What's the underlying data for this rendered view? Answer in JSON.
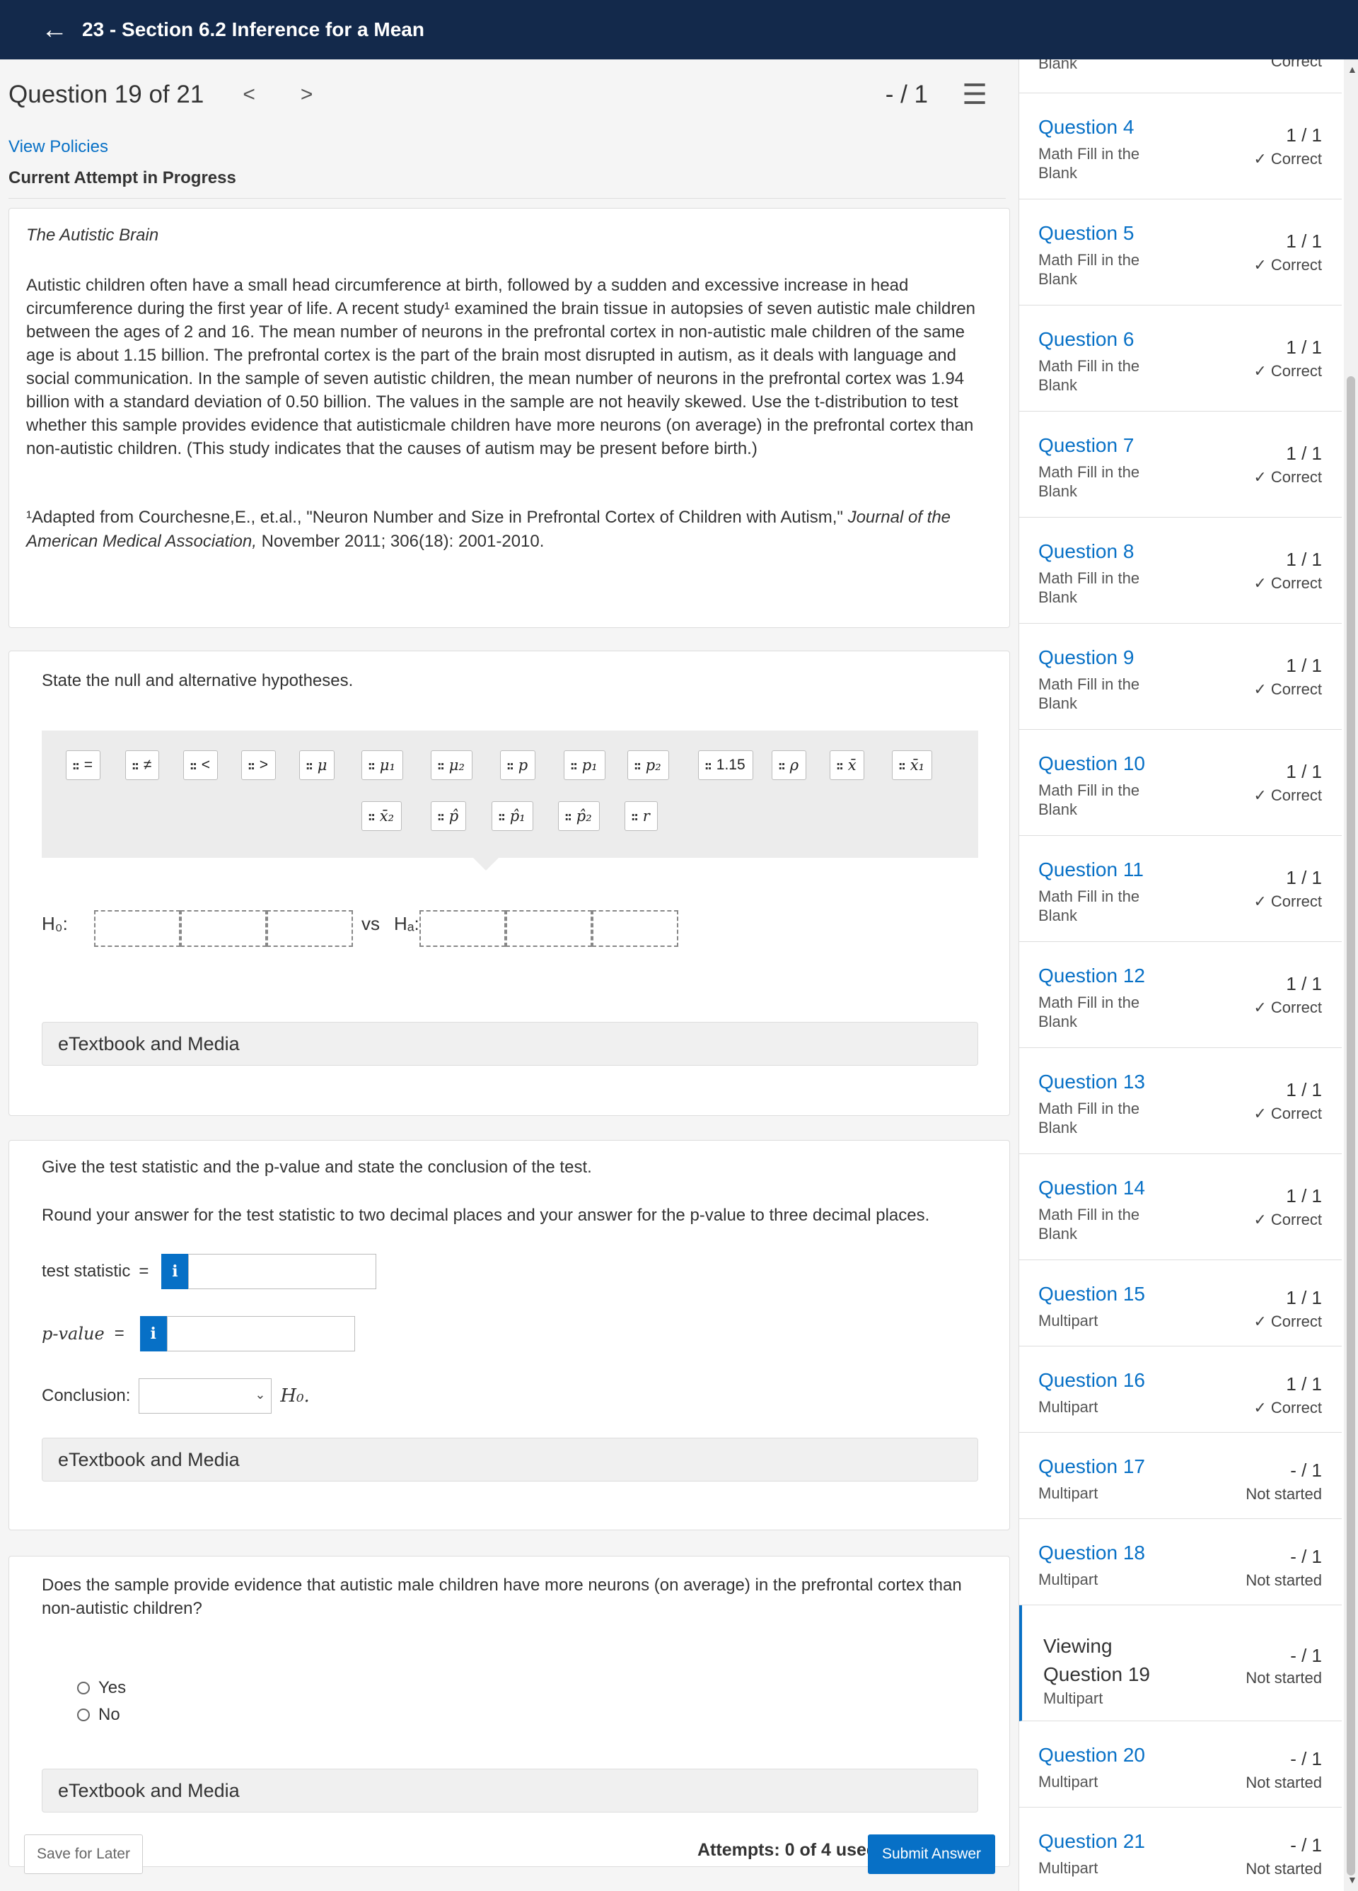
{
  "header": {
    "back_icon": "arrow-left-icon",
    "title": "23 - Section 6.2 Inference for a Mean"
  },
  "question": {
    "number_label": "Question 19 of 21",
    "prev": "<",
    "next": ">",
    "score": "- / 1",
    "list_icon": "numbered-list-icon",
    "view_policies": "View Policies",
    "attempt_status": "Current Attempt in Progress"
  },
  "problem": {
    "title": "The Autistic Brain",
    "text": "Autistic children often have a small head circumference at birth, followed by a sudden and excessive increase in head circumference during the first year of life. A recent study¹ examined the brain tissue in autopsies of seven autistic male children between the ages of 2 and 16. The mean number of neurons in the prefrontal cortex in non-autistic male children of the same age is about 1.15 billion. The prefrontal cortex is the part of the brain most disrupted in autism, as it deals with language and social communication. In the sample of seven autistic children, the mean number of neurons in the prefrontal cortex was 1.94 billion with a standard deviation of 0.50 billion. The values in the sample are not heavily skewed. Use the t-distribution to test whether this sample provides evidence that autisticmale children have more neurons (on average) in the prefrontal cortex than non-autistic children. (This study indicates that the causes of autism may be present before birth.)",
    "footnote_a": "¹Adapted from Courchesne,E., et.al., \"Neuron Number and Size in Prefrontal Cortex of Children with Autism,\"",
    "footnote_journal": "Journal of the American Medical Association,",
    "footnote_b": "November 2011; 306(18): 2001-2010."
  },
  "part1": {
    "prompt": "State the null and alternative hypotheses.",
    "chips_row1": [
      "=",
      "≠",
      "<",
      ">",
      "μ",
      "μ₁",
      "μ₂",
      "p",
      "p₁",
      "p₂",
      "1.15",
      "ρ",
      "x̄",
      "x̄₁"
    ],
    "chips_row2": [
      "x̄₂",
      "p̂",
      "p̂₁",
      "p̂₂",
      "r"
    ],
    "h0_label": "H₀:",
    "vs_label": "vs",
    "ha_label": "Hₐ:",
    "etextbook": "eTextbook and Media"
  },
  "part2": {
    "prompt": "Give the test statistic and the p-value and state the conclusion of the test.",
    "round_note": "Round your answer for the test statistic to two decimal places and your answer for the p-value to three decimal places.",
    "test_stat_label": "test statistic",
    "p_value_label": "p-value",
    "equals": "=",
    "info": "i",
    "conclusion_label": "Conclusion:",
    "conclusion_value": "",
    "h0_suffix": "H₀.",
    "etextbook": "eTextbook and Media"
  },
  "part3": {
    "prompt": "Does the sample provide evidence that autistic male children have more neurons (on average) in the prefrontal cortex than non-autistic children?",
    "options": [
      "Yes",
      "No"
    ],
    "etextbook": "eTextbook and Media"
  },
  "footer": {
    "save_later": "Save for Later",
    "attempts": "Attempts: 0 of 4 used",
    "submit": "Submit Answer"
  },
  "sidebar": {
    "top_partial_type": "Blank",
    "top_partial_status": "Correct",
    "items": [
      {
        "title": "Question 4",
        "type": "Math Fill in the Blank",
        "score": "1 / 1",
        "status": "✓ Correct"
      },
      {
        "title": "Question 5",
        "type": "Math Fill in the Blank",
        "score": "1 / 1",
        "status": "✓ Correct"
      },
      {
        "title": "Question 6",
        "type": "Math Fill in the Blank",
        "score": "1 / 1",
        "status": "✓ Correct"
      },
      {
        "title": "Question 7",
        "type": "Math Fill in the Blank",
        "score": "1 / 1",
        "status": "✓ Correct"
      },
      {
        "title": "Question 8",
        "type": "Math Fill in the Blank",
        "score": "1 / 1",
        "status": "✓ Correct"
      },
      {
        "title": "Question 9",
        "type": "Math Fill in the Blank",
        "score": "1 / 1",
        "status": "✓ Correct"
      },
      {
        "title": "Question 10",
        "type": "Math Fill in the Blank",
        "score": "1 / 1",
        "status": "✓ Correct"
      },
      {
        "title": "Question 11",
        "type": "Math Fill in the Blank",
        "score": "1 / 1",
        "status": "✓ Correct"
      },
      {
        "title": "Question 12",
        "type": "Math Fill in the Blank",
        "score": "1 / 1",
        "status": "✓ Correct"
      },
      {
        "title": "Question 13",
        "type": "Math Fill in the Blank",
        "score": "1 / 1",
        "status": "✓ Correct"
      },
      {
        "title": "Question 14",
        "type": "Math Fill in the Blank",
        "score": "1 / 1",
        "status": "✓ Correct"
      },
      {
        "title": "Question 15",
        "type": "Multipart",
        "score": "1 / 1",
        "status": "✓ Correct"
      },
      {
        "title": "Question 16",
        "type": "Multipart",
        "score": "1 / 1",
        "status": "✓ Correct"
      },
      {
        "title": "Question 17",
        "type": "Multipart",
        "score": "- / 1",
        "status": "Not started"
      },
      {
        "title": "Question 18",
        "type": "Multipart",
        "score": "- / 1",
        "status": "Not started"
      },
      {
        "title": "Viewing Question 19",
        "type": "Multipart",
        "score": "- / 1",
        "status": "Not started"
      },
      {
        "title": "Question 20",
        "type": "Multipart",
        "score": "- / 1",
        "status": "Not started"
      },
      {
        "title": "Question 21",
        "type": "Multipart",
        "score": "- / 1",
        "status": "Not started"
      }
    ]
  },
  "colors": {
    "header_bg": "#13294b",
    "link": "#0770c6",
    "submit_bg": "#0770c6"
  }
}
